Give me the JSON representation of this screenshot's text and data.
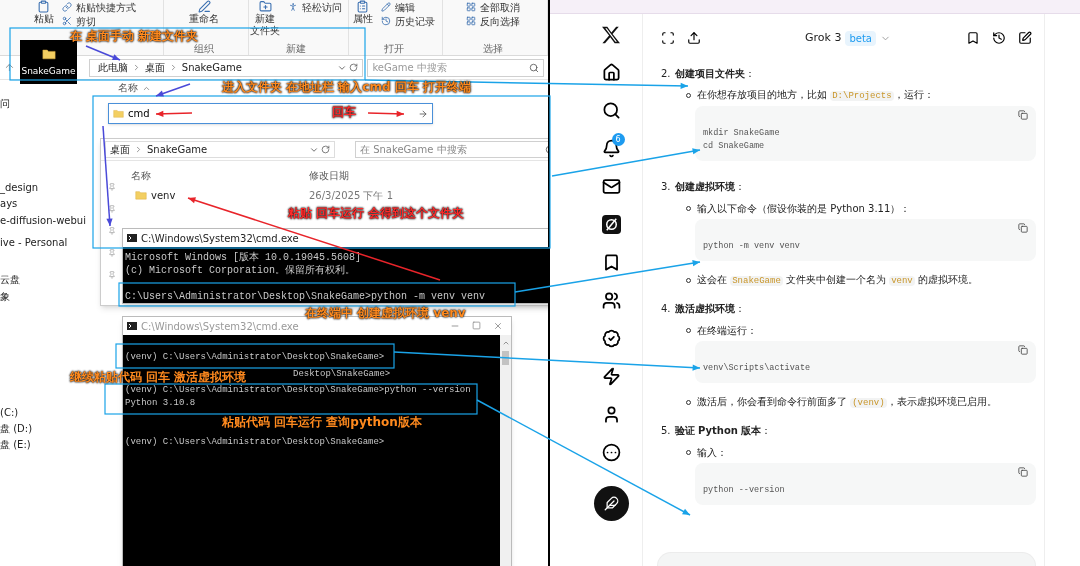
{
  "explorer": {
    "ribbon": {
      "groups": [
        {
          "items": [
            {
              "kind": "large",
              "lines": [
                "粘贴"
              ]
            },
            {
              "kind": "small",
              "lines": [
                "粘贴快捷方式"
              ]
            },
            {
              "kind": "small",
              "lines": [
                "剪切"
              ]
            }
          ]
        },
        {
          "label": "组织",
          "items": [
            {
              "kind": "large",
              "lines": [
                "重命名"
              ]
            }
          ]
        },
        {
          "label": "新建",
          "items": [
            {
              "kind": "large",
              "lines": [
                "新建",
                "文件夹"
              ]
            },
            {
              "kind": "small",
              "lines": [
                "轻松访问"
              ]
            }
          ]
        },
        {
          "label": "打开",
          "items": [
            {
              "kind": "large",
              "lines": [
                "属性"
              ]
            },
            {
              "kind": "small",
              "lines": [
                "编辑"
              ]
            },
            {
              "kind": "small",
              "lines": [
                "历史记录"
              ]
            }
          ]
        },
        {
          "label": "选择",
          "items": [
            {
              "kind": "small",
              "lines": [
                "全部取消"
              ]
            },
            {
              "kind": "small",
              "lines": [
                "反向选择"
              ]
            }
          ]
        }
      ]
    },
    "address_bar": {
      "crumbs": [
        "此电脑",
        "桌面",
        "SnakeGame"
      ],
      "search_placeholder": "keGame 中搜索"
    },
    "desktop_icon": {
      "label": "SnakeGame"
    },
    "nav_pane": [
      "问",
      "_design",
      "ays",
      "e-diffusion-webui",
      "ive - Personal",
      "云盘",
      "象",
      "(C:)",
      "盘 (D:)",
      "盘 (E:)"
    ],
    "column_header": "名称",
    "address_input": {
      "value": "cmd"
    }
  },
  "folder_window": {
    "crumbs": [
      "桌面",
      "SnakeGame"
    ],
    "search_placeholder": "在 SnakeGame 中搜索",
    "columns": [
      "名称",
      "修改日期"
    ],
    "rows": [
      {
        "name": "venv",
        "date": "26/3/2025 下午 1"
      }
    ]
  },
  "terminals": [
    {
      "title": "C:\\Windows\\System32\\cmd.exe",
      "lines": [
        {
          "kind": "line",
          "text": "Microsoft Windows [版本 10.0.19045.5608]"
        },
        {
          "kind": "line",
          "text": "(c) Microsoft Corporation。保留所有权利。"
        },
        {
          "kind": "blank"
        },
        {
          "kind": "line",
          "text": "C:\\Users\\Administrator\\Desktop\\SnakeGame>python -m venv venv"
        }
      ]
    },
    {
      "title": "C:\\Windows\\System32\\cmd.exe",
      "lines": [
        {
          "kind": "line",
          "text": "(venv) C:\\Users\\Administrator\\Desktop\\SnakeGame>"
        },
        {
          "kind": "partial",
          "text": "Desktop\\SnakeGame>"
        },
        {
          "kind": "line",
          "text": "(venv) C:\\Users\\Administrator\\Desktop\\SnakeGame>python --version"
        },
        {
          "kind": "line",
          "text": "Python 3.10.8"
        },
        {
          "kind": "blank"
        },
        {
          "kind": "line",
          "text": "(venv) C:\\Users\\Administrator\\Desktop\\SnakeGame>"
        }
      ]
    }
  ],
  "annotations": [
    {
      "kind": "note",
      "text": "在 桌面手动 新建文件夹"
    },
    {
      "kind": "note",
      "text": "进入文件夹 在地址栏 输入cmd  回车 打开终端"
    },
    {
      "kind": "alert",
      "text": "回车"
    },
    {
      "kind": "alert",
      "text": "粘贴 回车运行  会得到这个文件夹"
    },
    {
      "kind": "note",
      "text": "在终端中 创建虚拟环境 venv"
    },
    {
      "kind": "note",
      "text": "继续粘贴代码 回车 激活虚拟环境"
    },
    {
      "kind": "note",
      "text": "粘贴代码 回车运行  查询python版本"
    }
  ],
  "x_sidebar": {
    "notification_count": "6"
  },
  "chat": {
    "model": "Grok 3",
    "badge": "beta",
    "steps": [
      {
        "number": "2.",
        "title": "**创建项目文件夹**：",
        "blocks": [
          {
            "kind": "text",
            "parts": [
              {
                "text": "在你想存放项目的地方，比如 "
              },
              {
                "code": "D:\\Projects"
              },
              {
                "text": "，运行："
              }
            ]
          },
          {
            "kind": "code",
            "lines": [
              "mkdir SnakeGame",
              "cd SnakeGame"
            ]
          }
        ]
      },
      {
        "number": "3.",
        "title": "**创建虚拟环境**：",
        "blocks": [
          {
            "kind": "text",
            "parts": [
              {
                "text": "输入以下命令（假设你装的是 Python 3.11）："
              }
            ]
          },
          {
            "kind": "code",
            "lines": [
              "python -m venv venv"
            ]
          },
          {
            "kind": "text",
            "parts": [
              {
                "text": "这会在 "
              },
              {
                "code": "SnakeGame"
              },
              {
                "text": " 文件夹中创建一个名为 "
              },
              {
                "code": "venv"
              },
              {
                "text": " 的虚拟环境。"
              }
            ]
          }
        ]
      },
      {
        "number": "4.",
        "title": "**激活虚拟环境**：",
        "blocks": [
          {
            "kind": "text",
            "parts": [
              {
                "text": "在终端运行："
              }
            ]
          },
          {
            "kind": "code",
            "lines": [
              "venv\\Scripts\\activate"
            ]
          },
          {
            "kind": "text",
            "parts": [
              {
                "text": "激活后，你会看到命令行前面多了 "
              },
              {
                "code": "(venv)"
              },
              {
                "text": "，表示虚拟环境已启用。"
              }
            ]
          }
        ]
      },
      {
        "number": "5.",
        "title": "**验证 Python 版本**：",
        "blocks": [
          {
            "kind": "text",
            "parts": [
              {
                "text": "输入："
              }
            ]
          },
          {
            "kind": "code",
            "lines": [
              "python --version"
            ]
          }
        ]
      }
    ]
  }
}
